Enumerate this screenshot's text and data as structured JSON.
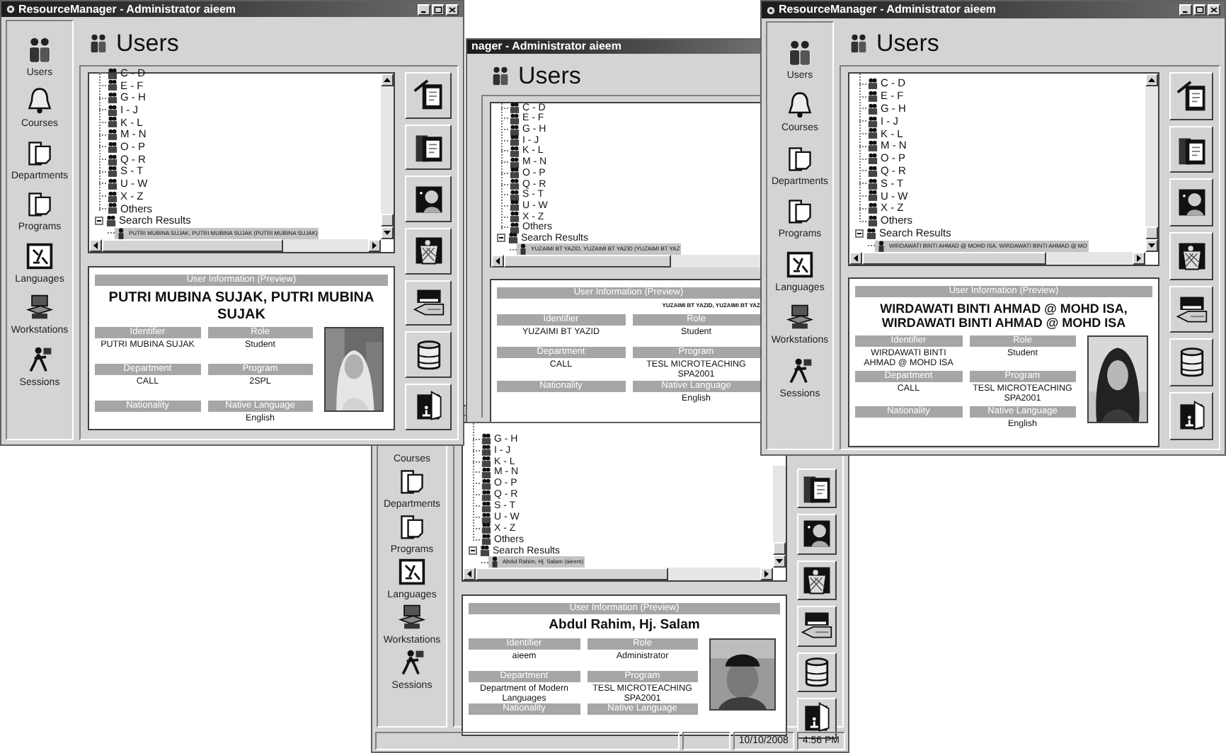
{
  "windows": [
    {
      "title": "ResourceManager - Administrator aieem",
      "window_controls": [
        {
          "kind": "minimize"
        },
        {
          "kind": "maximize"
        },
        {
          "kind": "close"
        }
      ],
      "sidebar": [
        {
          "kind": "users",
          "label": "Users"
        },
        {
          "kind": "courses",
          "label": "Courses"
        },
        {
          "kind": "departments",
          "label": "Departments"
        },
        {
          "kind": "programs",
          "label": "Programs"
        },
        {
          "kind": "languages",
          "label": "Languages"
        },
        {
          "kind": "workstations",
          "label": "Workstations"
        },
        {
          "kind": "sessions",
          "label": "Sessions"
        }
      ],
      "header": "Users",
      "tree": {
        "groups": [
          {
            "label": "C - D",
            "selected": false
          },
          {
            "label": "E - F",
            "selected": false
          },
          {
            "label": "G - H",
            "selected": false
          },
          {
            "label": "I - J",
            "selected": false
          },
          {
            "label": "K - L",
            "selected": false
          },
          {
            "label": "M - N",
            "selected": false
          },
          {
            "label": "O - P",
            "selected": false
          },
          {
            "label": "Q - R",
            "selected": false
          },
          {
            "label": "S - T",
            "selected": false
          },
          {
            "label": "U - W",
            "selected": false
          },
          {
            "label": "X - Z",
            "selected": false
          },
          {
            "label": "Others",
            "selected": false
          }
        ],
        "search_results": "Search Results",
        "results": [
          {
            "label": "PUTRI MUBINA SUJAK, PUTRI MUBINA SUJAK (PUTRI MUBINA SUJAK)",
            "selected": true
          }
        ]
      },
      "info": {
        "heading": "User Information (Preview)",
        "name": "PUTRI MUBINA SUJAK, PUTRI MUBINA SUJAK",
        "fields": [
          {
            "label": "Identifier",
            "value": "PUTRI MUBINA SUJAK"
          },
          {
            "label": "Role",
            "value": "Student"
          },
          {
            "label": "Department",
            "value": "CALL"
          },
          {
            "label": "Program",
            "value": "2SPL"
          },
          {
            "label": "Nationality"
          },
          {
            "label": "Native Language",
            "value": "English"
          }
        ]
      },
      "toolbar": [
        {
          "kind": "new"
        },
        {
          "kind": "edit"
        },
        {
          "kind": "portrait"
        },
        {
          "kind": "delete"
        },
        {
          "kind": "import"
        },
        {
          "kind": "database"
        },
        {
          "kind": "exit"
        }
      ]
    },
    {
      "title": "nager - Administrator aieem",
      "header": "Users",
      "tree": {
        "groups": [
          {
            "label": "C - D",
            "selected": false
          },
          {
            "label": "E - F",
            "selected": false
          },
          {
            "label": "G - H",
            "selected": false
          },
          {
            "label": "I - J",
            "selected": false
          },
          {
            "label": "K - L",
            "selected": false
          },
          {
            "label": "M - N",
            "selected": false
          },
          {
            "label": "O - P",
            "selected": false
          },
          {
            "label": "Q - R",
            "selected": false
          },
          {
            "label": "S - T",
            "selected": false
          },
          {
            "label": "U - W",
            "selected": false
          },
          {
            "label": "X - Z",
            "selected": false
          },
          {
            "label": "Others",
            "selected": false
          }
        ],
        "search_results": "Search Results",
        "results": [
          {
            "label": "YUZAIMI BT YAZID, YUZAIMI BT YAZID (YUZAIMI BT YAZ",
            "selected": true
          }
        ]
      },
      "info": {
        "heading": "User Information (Preview)",
        "name": "YUZAIMI BT YAZID, YUZAIMI BT YAZ",
        "fields": [
          {
            "label": "Identifier",
            "value": "YUZAIMI BT YAZID"
          },
          {
            "label": "Role",
            "value": "Student"
          },
          {
            "label": "Department",
            "value": "CALL"
          },
          {
            "label": "Program",
            "value": "TESL MICROTEACHING SPA2001"
          },
          {
            "label": "Nationality"
          },
          {
            "label": "Native Language",
            "value": "English"
          }
        ]
      }
    },
    {
      "title": "ResourceManager - Administrator aieem",
      "window_controls": [
        {
          "kind": "minimize"
        },
        {
          "kind": "maximize"
        },
        {
          "kind": "close"
        }
      ],
      "sidebar": [
        {
          "kind": "users",
          "label": "Users"
        },
        {
          "kind": "courses",
          "label": "Courses"
        },
        {
          "kind": "departments",
          "label": "Departments"
        },
        {
          "kind": "programs",
          "label": "Programs"
        },
        {
          "kind": "languages",
          "label": "Languages"
        },
        {
          "kind": "workstations",
          "label": "Workstations"
        },
        {
          "kind": "sessions",
          "label": "Sessions"
        }
      ],
      "header": "Users",
      "tree": {
        "groups": [
          {
            "label": "C - D",
            "selected": false
          },
          {
            "label": "E - F",
            "selected": false
          },
          {
            "label": "G - H",
            "selected": false
          },
          {
            "label": "I - J",
            "selected": false
          },
          {
            "label": "K - L",
            "selected": false
          },
          {
            "label": "M - N",
            "selected": false
          },
          {
            "label": "O - P",
            "selected": false
          },
          {
            "label": "Q - R",
            "selected": false
          },
          {
            "label": "S - T",
            "selected": false
          },
          {
            "label": "U - W",
            "selected": false
          },
          {
            "label": "X - Z",
            "selected": false
          },
          {
            "label": "Others",
            "selected": false
          }
        ],
        "search_results": "Search Results",
        "results": [
          {
            "label": "WIRDAWATI BINTI AHMAD @ MOHD ISA, WIRDAWATI BINTI AHMAD @ MO",
            "selected": true
          }
        ]
      },
      "info": {
        "heading": "User Information (Preview)",
        "name": "WIRDAWATI BINTI AHMAD @ MOHD ISA, WIRDAWATI BINTI AHMAD @ MOHD ISA",
        "fields": [
          {
            "label": "Identifier",
            "value": "WIRDAWATI BINTI AHMAD @ MOHD ISA"
          },
          {
            "label": "Role",
            "value": "Student"
          },
          {
            "label": "Department",
            "value": "CALL"
          },
          {
            "label": "Program",
            "value": "TESL MICROTEACHING SPA2001"
          },
          {
            "label": "Nationality"
          },
          {
            "label": "Native Language",
            "value": "English"
          }
        ]
      },
      "toolbar": [
        {
          "kind": "new"
        },
        {
          "kind": "edit"
        },
        {
          "kind": "portrait"
        },
        {
          "kind": "delete"
        },
        {
          "kind": "import"
        },
        {
          "kind": "database"
        },
        {
          "kind": "exit"
        }
      ]
    },
    {
      "sidebar": [
        {
          "kind": "courses",
          "label": "Courses"
        },
        {
          "kind": "departments",
          "label": "Departments"
        },
        {
          "kind": "programs",
          "label": "Programs"
        },
        {
          "kind": "languages",
          "label": "Languages"
        },
        {
          "kind": "workstations",
          "label": "Workstations"
        },
        {
          "kind": "sessions",
          "label": "Sessions"
        }
      ],
      "tree": {
        "groups": [
          {
            "label": "G - H",
            "selected": false
          },
          {
            "label": "I - J",
            "selected": false
          },
          {
            "label": "K - L",
            "selected": false
          },
          {
            "label": "M - N",
            "selected": false
          },
          {
            "label": "O - P",
            "selected": false
          },
          {
            "label": "Q - R",
            "selected": false
          },
          {
            "label": "S - T",
            "selected": false
          },
          {
            "label": "U - W",
            "selected": false
          },
          {
            "label": "X - Z",
            "selected": false
          },
          {
            "label": "Others",
            "selected": false
          }
        ],
        "search_results": "Search Results",
        "results": [
          {
            "label": "Abdul Rahim, Hj. Salam (aieem)",
            "selected": true
          }
        ]
      },
      "info": {
        "heading": "User Information (Preview)",
        "name": "Abdul Rahim, Hj. Salam",
        "fields": [
          {
            "label": "Identifier",
            "value": "aieem"
          },
          {
            "label": "Role",
            "value": "Administrator"
          },
          {
            "label": "Department",
            "value": "Department of Modern Languages"
          },
          {
            "label": "Program",
            "value": "TESL MICROTEACHING SPA2001"
          },
          {
            "label": "Nationality"
          },
          {
            "label": "Native Language"
          }
        ]
      },
      "toolbar": [
        {
          "kind": "edit"
        },
        {
          "kind": "portrait"
        },
        {
          "kind": "delete"
        },
        {
          "kind": "import"
        },
        {
          "kind": "database"
        },
        {
          "kind": "exit"
        }
      ],
      "status_bar": [
        "10/10/2008",
        "4:56 PM"
      ]
    }
  ]
}
